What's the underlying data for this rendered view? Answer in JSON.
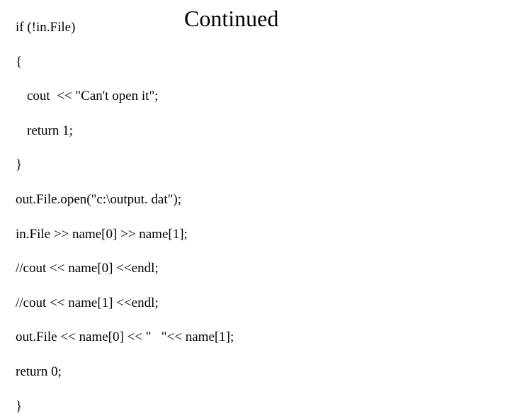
{
  "title": "Continued",
  "lines": {
    "l1": "if (!in.File)",
    "l2": "{",
    "l3": "cout  << \"Can't open it\";",
    "l4": "return 1;",
    "l5": "}",
    "l6": "out.File.open(\"c:\\output. dat\");",
    "l7": "in.File >> name[0] >> name[1];",
    "l8": "//cout << name[0] <<endl;",
    "l9": "//cout << name[1] <<endl;",
    "l10": "out.File << name[0] << \"   \"<< name[1];",
    "l11": "return 0;",
    "l12": "}"
  }
}
